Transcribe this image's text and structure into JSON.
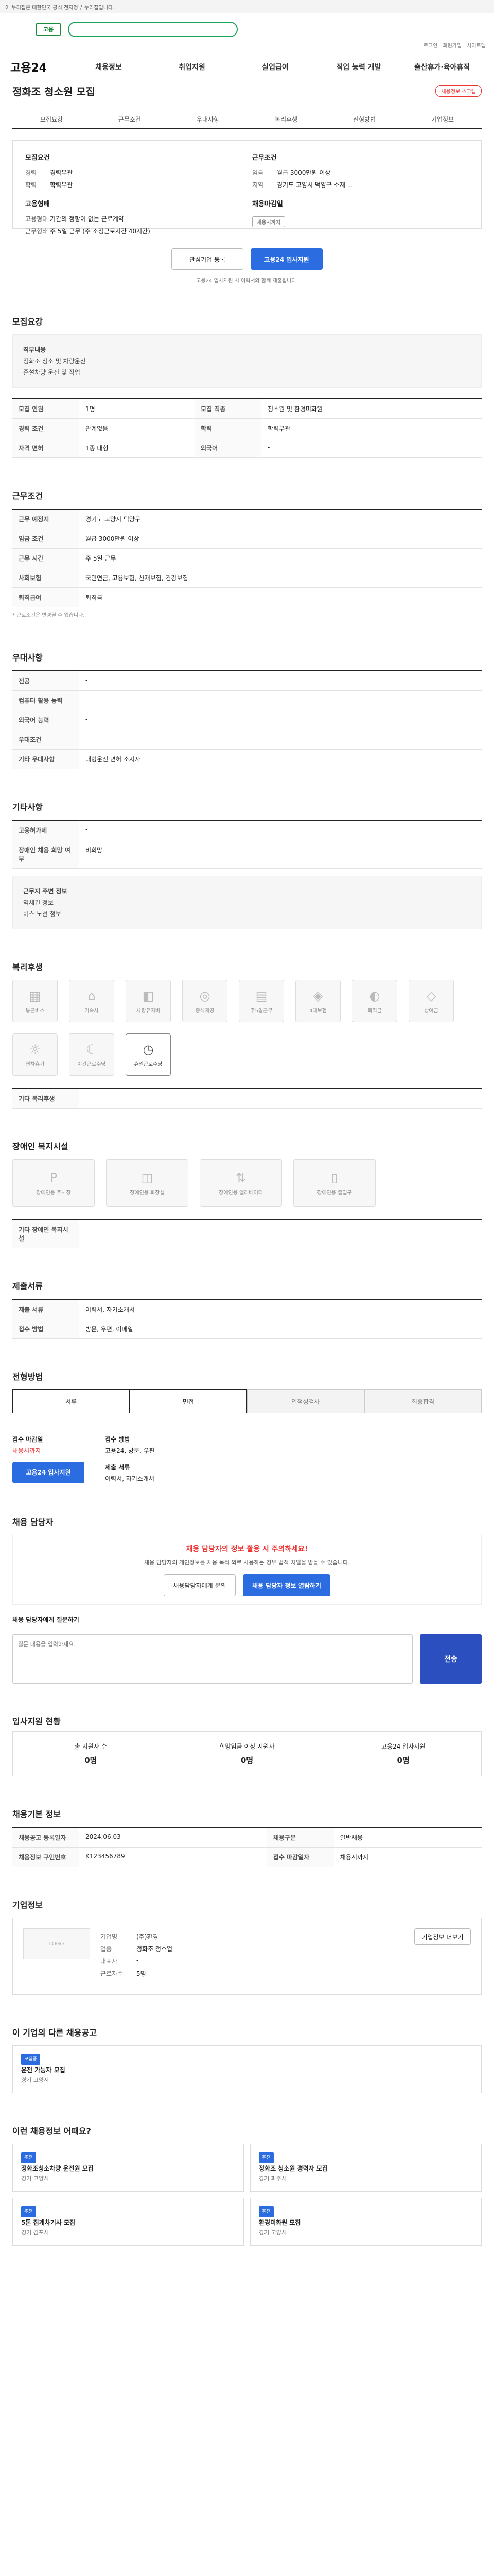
{
  "topbar": {
    "text": "이 누리집은 대한민국 공식 전자정부 누리집입니다."
  },
  "header": {
    "logo": "고용",
    "brand": "고용24",
    "links": [
      "로그인",
      "회원가입",
      "사이트맵"
    ]
  },
  "nav": [
    "채용정보",
    "취업지원",
    "실업급여",
    "직업 능력 개발",
    "출산휴가·육아휴직"
  ],
  "job": {
    "title": "정화조 청소원 모집",
    "badge": "채용정보 스크랩",
    "tabs": [
      "모집요강",
      "근무조건",
      "우대사항",
      "복리후생",
      "전형방법",
      "기업정보"
    ],
    "recruit": {
      "heading": "모집요건",
      "items": [
        [
          "경력",
          "경력무관"
        ],
        [
          "학력",
          "학력무관"
        ]
      ]
    },
    "work": {
      "heading": "근무조건",
      "items": [
        [
          "임금",
          "월급 3000만원 이상"
        ],
        [
          "지역",
          "경기도 고양시 덕양구 소재 ..."
        ]
      ]
    },
    "form": {
      "heading": "고용형태",
      "items": [
        [
          "고용형태",
          "기간의 정함이 없는 근로계약"
        ],
        [
          "근무형태",
          "주 5일 근무 (주 소정근로시간 40시간)"
        ]
      ]
    },
    "deadline": {
      "heading": "채용마감일",
      "value": "채용시까지"
    },
    "buttons": {
      "interest": "관심기업 등록",
      "apply": "고용24 입사지원"
    },
    "note": "고용24 입사지원 시 이력서와 함께 제출됩니다."
  },
  "sections": {
    "recruit": {
      "title": "모집요강",
      "desc_title": "직무내용",
      "desc": [
        "정화조 청소 및 차량운전",
        "준설차량 운전 및 작업"
      ],
      "rows": [
        [
          "모집 인원",
          "1명"
        ],
        [
          "모집 직종",
          "청소원 및 환경미화원"
        ],
        [
          "경력 조건",
          "관계없음"
        ],
        [
          "학력",
          "학력무관"
        ],
        [
          "자격 면허",
          "1종 대형"
        ],
        [
          "외국어",
          "-"
        ]
      ]
    },
    "work": {
      "title": "근무조건",
      "rows": [
        [
          "근무 예정지",
          "경기도 고양시 덕양구"
        ],
        [
          "임금 조건",
          "월급 3000만원 이상"
        ],
        [
          "근무 시간",
          "주 5일 근무"
        ],
        [
          "사회보험",
          "국민연금, 고용보험, 산재보험, 건강보험"
        ],
        [
          "퇴직급여",
          "퇴직금"
        ]
      ],
      "note": "* 근로조건은 변경될 수 있습니다."
    },
    "pref": {
      "title": "우대사항",
      "rows": [
        [
          "전공",
          "-"
        ],
        [
          "컴퓨터 활용 능력",
          "-"
        ],
        [
          "외국어 능력",
          "-"
        ],
        [
          "우대조건",
          "-"
        ],
        [
          "기타 우대사항",
          "대형운전 면허 소지자"
        ]
      ]
    },
    "etc": {
      "title": "기타사항",
      "rows": [
        [
          "고용허가제",
          "-"
        ],
        [
          "장애인 채용 희망 여부",
          "비희망"
        ]
      ],
      "info_title": "근무지 주변 정보",
      "info": [
        "역세권 정보",
        "버스 노선 정보"
      ]
    },
    "welfare": {
      "title": "복리후생",
      "icons": [
        "통근버스",
        "기숙사",
        "차량유지비",
        "중식제공",
        "주5일근무",
        "4대보험",
        "퇴직금",
        "상여금",
        "연차휴가",
        "야간근로수당",
        "휴일근로수당"
      ],
      "etc_label": "기타 복리후생",
      "etc_value": "-"
    },
    "disabled": {
      "title": "장애인 복지시설",
      "icons": [
        "장애인용 주차장",
        "장애인용 화장실",
        "장애인용 엘리베이터",
        "장애인용 출입구"
      ],
      "etc_label": "기타 장애인 복지시설",
      "etc_value": "-"
    },
    "apply_docs": {
      "title": "제출서류",
      "rows": [
        [
          "제출 서류",
          "이력서, 자기소개서"
        ],
        [
          "접수 방법",
          "방문, 우편, 이메일"
        ]
      ]
    },
    "process": {
      "title": "전형방법",
      "steps": [
        "서류",
        "면접",
        "인적성검사",
        "최종합격"
      ]
    },
    "apply": {
      "deadline_label": "접수 마감일",
      "deadline_value": "채용시까지",
      "method_label": "접수 방법",
      "method_value": "고용24, 방문, 우편",
      "apply_btn": "고용24 입사지원",
      "doc_label": "제출 서류",
      "doc_value": "이력서, 자기소개서"
    }
  },
  "contact": {
    "title": "채용 담당자",
    "warn_title": "채용 담당자의 정보 활용 시 주의하세요!",
    "warn_desc": "채용 담당자의 개인정보를 채용 목적 외로 사용하는 경우 법적 처벌을 받을 수 있습니다.",
    "btn1": "채용담당자에게 문의",
    "btn2": "채용 담당자 정보 열람하기",
    "qna_title": "채용 담당자에게 질문하기",
    "qna_placeholder": "질문 내용을 입력하세요.",
    "qna_btn": "전송"
  },
  "stats": {
    "title": "입사지원 현황",
    "items": [
      [
        "총 지원자 수",
        "0명"
      ],
      [
        "희망임금 이상 지원자",
        "0명"
      ],
      [
        "고용24 입사지원",
        "0명"
      ]
    ]
  },
  "basic": {
    "title": "채용기본 정보",
    "rows": [
      [
        "채용공고 등록일자",
        "2024.06.03",
        "채용구분",
        "일반채용"
      ],
      [
        "채용정보 구인번호",
        "K123456789",
        "접수 마감일자",
        "채용시까지"
      ]
    ]
  },
  "company": {
    "title": "기업정보",
    "logo": "LOGO",
    "rows": [
      [
        "기업명",
        "(주)환경"
      ],
      [
        "업종",
        "정화조 청소업"
      ],
      [
        "대표자",
        "-"
      ],
      [
        "근로자수",
        "5명"
      ]
    ],
    "btn": "기업정보 더보기"
  },
  "similar": {
    "title": "이 기업의 다른 채용공고",
    "items": [
      {
        "tag": "모집중",
        "title": "운전 가능자 모집",
        "meta": "경기 고양시"
      }
    ]
  },
  "recommend": {
    "title": "이런 채용정보 어때요?",
    "items": [
      {
        "tag": "추천",
        "title": "정화조청소차량 운전원 모집",
        "meta": "경기 고양시"
      },
      {
        "tag": "추천",
        "title": "정화조 청소원 경력자 모집",
        "meta": "경기 파주시"
      },
      {
        "tag": "추천",
        "title": "5톤 집게차기사 모집",
        "meta": "경기 김포시"
      },
      {
        "tag": "추천",
        "title": "환경미화원 모집",
        "meta": "경기 고양시"
      }
    ]
  }
}
